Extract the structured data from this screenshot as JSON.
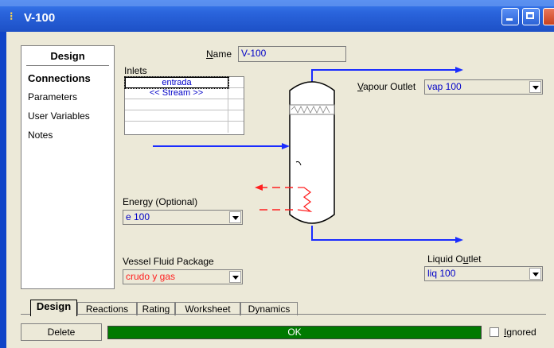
{
  "window": {
    "title": "V-100",
    "icon": "hysys-app-icon",
    "controls": [
      "minimize-icon",
      "maximize-icon",
      "close-icon"
    ]
  },
  "nav": {
    "header": "Design",
    "items": [
      {
        "label": "Connections",
        "selected": true
      },
      {
        "label": "Parameters",
        "selected": false
      },
      {
        "label": "User Variables",
        "selected": false
      },
      {
        "label": "Notes",
        "selected": false
      }
    ]
  },
  "name_field": {
    "label_u": "N",
    "label_rest": "ame",
    "value": "V-100"
  },
  "inlets": {
    "label": "Inlets",
    "rows": [
      "entrada",
      "<< Stream >>",
      "",
      "",
      ""
    ]
  },
  "vapour_outlet": {
    "label_u": "V",
    "label_rest": "apour Outlet",
    "value": "vap 100"
  },
  "energy": {
    "label_pre": "Ener",
    "label_u": "g",
    "label_rest": "y (Optional)",
    "value": "e 100"
  },
  "fluid_package": {
    "label": "Vessel Fluid Package",
    "value": "crudo y gas"
  },
  "liquid_outlet": {
    "label_pre": "Liquid O",
    "label_u": "u",
    "label_rest": "tlet",
    "value": "liq 100"
  },
  "tabs": [
    "Design",
    "Reactions",
    "Rating",
    "Worksheet",
    "Dynamics"
  ],
  "active_tab": "Design",
  "footer": {
    "delete_label": "Delete",
    "status": "OK",
    "ignored_label_u": "I",
    "ignored_label_rest": "gnored",
    "ignored_checked": false
  },
  "colors": {
    "stream": "#1a2cff",
    "energy": "#ff2020",
    "status_ok": "#007a00",
    "titlebar": "#2a64dc"
  }
}
